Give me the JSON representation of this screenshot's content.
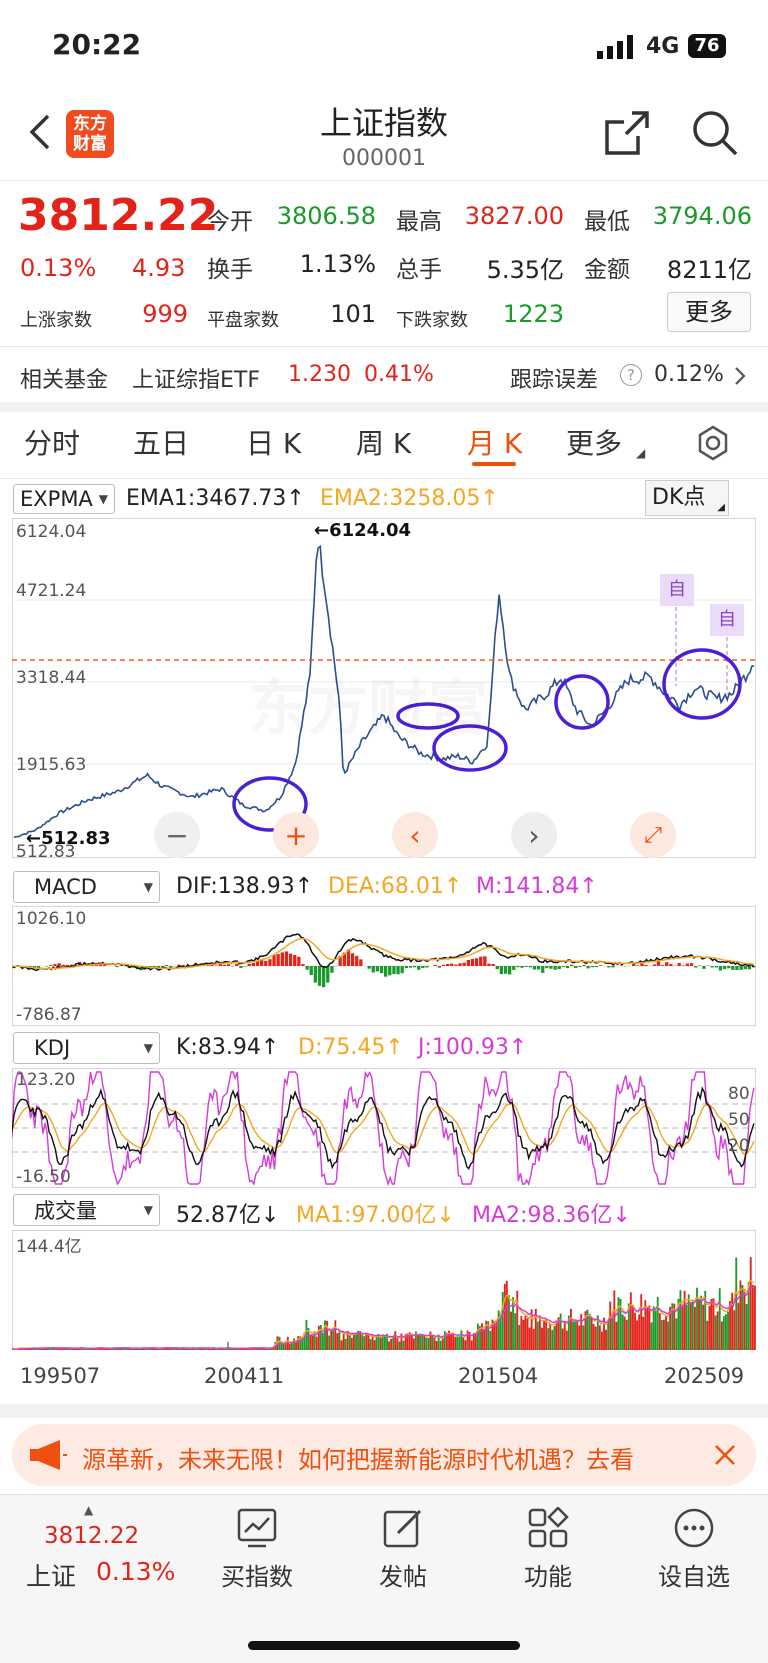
{
  "status_bar": {
    "time": "20:22",
    "network": "4G",
    "battery": "76"
  },
  "header": {
    "title": "上证指数",
    "code": "000001",
    "logo_text": "东方财富"
  },
  "quote": {
    "price": "3812.22",
    "change_pct": "0.13%",
    "change": "4.93",
    "stats": [
      {
        "label": "今开",
        "value": "3806.58"
      },
      {
        "label": "最高",
        "value": "3827.00"
      },
      {
        "label": "最低",
        "value": "3794.06"
      },
      {
        "label": "换手",
        "value": "1.13%"
      },
      {
        "label": "总手",
        "value": "5.35亿"
      },
      {
        "label": "金额",
        "value": "8211亿"
      }
    ],
    "up_label": "上涨家数",
    "up_value": "999",
    "flat_label": "平盘家数",
    "flat_value": "101",
    "down_label": "下跌家数",
    "down_value": "1223",
    "more_label": "更多"
  },
  "fund": {
    "label": "相关基金",
    "name": "上证综指ETF",
    "price": "1.230",
    "pct": "0.41%",
    "tracking_label": "跟踪误差",
    "tracking_value": "0.12%"
  },
  "tabs": [
    "分时",
    "五日",
    "日 K",
    "周 K",
    "月 K",
    "更多"
  ],
  "active_tab": "月 K",
  "main_panel": {
    "indicator": "EXPMA",
    "ema1": "EMA1:3467.73",
    "ema2": "EMA2:3258.05",
    "dk_label": "DK点",
    "y_labels": [
      "6124.04",
      "4721.24",
      "3318.44",
      "1915.63",
      "512.83"
    ],
    "max_annotation": "6124.04",
    "min_annotation": "512.83",
    "mark_label": "自",
    "watermark": "东方财富"
  },
  "macd_panel": {
    "indicator": "MACD",
    "dif": "DIF:138.93",
    "dea": "DEA:68.01",
    "m": "M:141.84",
    "y_top": "1026.10",
    "y_bottom": "-786.87"
  },
  "kdj_panel": {
    "indicator": "KDJ",
    "k": "K:83.94",
    "d": "D:75.45",
    "j": "J:100.93",
    "y_top": "123.20",
    "y_bottom": "-16.50",
    "levels": [
      "80",
      "50",
      "20"
    ]
  },
  "vol_panel": {
    "indicator": "成交量",
    "vol": "52.87亿",
    "ma1": "MA1:97.00亿",
    "ma2": "MA2:98.36亿",
    "y_top": "144.4亿"
  },
  "x_labels": [
    "199507",
    "200411",
    "201504",
    "202509"
  ],
  "banner": {
    "text": "源革新，未来无限！如何把握新能源时代机遇？去看"
  },
  "bottom_nav": {
    "index_price": "3812.22",
    "index_name": "上证",
    "index_pct": "0.13%",
    "items": [
      "买指数",
      "发帖",
      "功能",
      "设自选"
    ]
  },
  "colors": {
    "red": "#e2231a",
    "green": "#1a9a2a",
    "orange": "#f5a623",
    "magenta": "#d63bd8",
    "line": "#2b4f8f",
    "annotation": "#4b1fd6"
  }
}
